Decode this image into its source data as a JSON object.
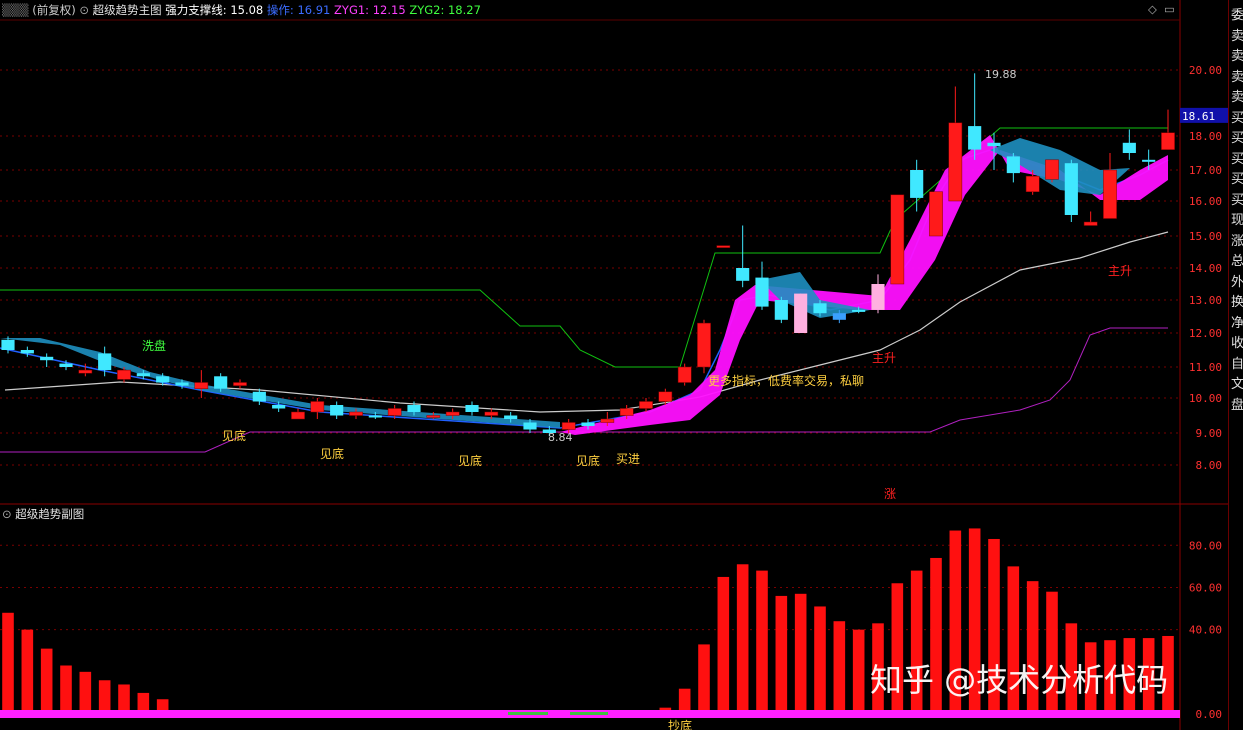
{
  "header": {
    "mode_label": "(前复权)",
    "indicator_title": "超级趋势主图",
    "support_label": "强力支撑线:",
    "support_value": "15.08",
    "op_label": "操作:",
    "op_value": "16.91",
    "zyg1_label": "ZYG1:",
    "zyg1_value": "12.15",
    "zyg2_label": "ZYG2:",
    "zyg2_value": "18.27",
    "sub_title": "超级趋势副图",
    "colors": {
      "title": "#e0e0e0",
      "support": "#ffffff",
      "op": "#3b6cff",
      "zyg1": "#ff40ff",
      "zyg2": "#40ff40"
    }
  },
  "sidebar": {
    "chars": [
      "委",
      "卖",
      "卖",
      "卖",
      "卖",
      "买",
      "买",
      "买",
      "买",
      "买",
      "现",
      "涨",
      "总",
      "外",
      "换",
      "净",
      "收",
      "自",
      "文",
      "盘"
    ]
  },
  "watermark": "知乎 @技术分析代码",
  "chart_data": [
    {
      "type": "candlestick",
      "title": "超级趋势主图",
      "ylim": [
        7.7,
        20.8
      ],
      "yticks": [
        "8.00",
        "9.00",
        "10.00",
        "11.00",
        "12.00",
        "13.00",
        "14.00",
        "15.00",
        "16.00",
        "17.00",
        "18.00",
        "20.00"
      ],
      "current_price": "18.61",
      "high_mark": "19.88",
      "low_mark": "8.84",
      "up_color": "#ff2020",
      "down_color": "#40e8ff",
      "candles": [
        [
          11.8,
          11.9,
          11.5,
          11.4,
          0
        ],
        [
          11.5,
          11.6,
          11.4,
          11.3,
          0
        ],
        [
          11.3,
          11.4,
          11.2,
          11.0,
          0
        ],
        [
          11.1,
          11.2,
          11.0,
          10.9,
          0
        ],
        [
          10.9,
          11.1,
          10.8,
          10.7,
          1
        ],
        [
          11.4,
          11.6,
          10.9,
          10.7,
          0
        ],
        [
          10.9,
          11.0,
          10.6,
          10.5,
          1
        ],
        [
          10.8,
          10.9,
          10.7,
          10.6,
          0
        ],
        [
          10.7,
          10.8,
          10.5,
          10.4,
          0
        ],
        [
          10.5,
          10.6,
          10.4,
          10.3,
          0
        ],
        [
          10.5,
          10.9,
          10.3,
          10.0,
          1
        ],
        [
          10.7,
          10.8,
          10.3,
          10.2,
          0
        ],
        [
          10.5,
          10.6,
          10.4,
          10.3,
          1
        ],
        [
          10.2,
          10.3,
          9.9,
          9.8,
          0
        ],
        [
          9.8,
          9.9,
          9.7,
          9.6,
          0
        ],
        [
          9.4,
          9.7,
          9.6,
          9.4,
          1
        ],
        [
          9.9,
          10.0,
          9.6,
          9.4,
          1
        ],
        [
          9.8,
          9.9,
          9.5,
          9.4,
          0
        ],
        [
          9.6,
          9.7,
          9.5,
          9.4,
          1
        ],
        [
          9.5,
          9.6,
          9.5,
          9.4,
          0
        ],
        [
          9.7,
          9.8,
          9.5,
          9.4,
          1
        ],
        [
          9.8,
          9.9,
          9.6,
          9.5,
          0
        ],
        [
          9.5,
          9.6,
          9.5,
          9.4,
          1
        ],
        [
          9.6,
          9.7,
          9.5,
          9.4,
          1
        ],
        [
          9.8,
          9.9,
          9.6,
          9.5,
          0
        ],
        [
          9.6,
          9.7,
          9.5,
          9.4,
          1
        ],
        [
          9.5,
          9.6,
          9.4,
          9.3,
          0
        ],
        [
          9.3,
          9.4,
          9.1,
          9.0,
          0
        ],
        [
          9.1,
          9.2,
          9.0,
          8.9,
          0
        ],
        [
          9.3,
          9.4,
          9.1,
          9.0,
          1
        ],
        [
          9.3,
          9.4,
          9.2,
          9.1,
          0
        ],
        [
          9.4,
          9.6,
          9.3,
          9.2,
          1
        ],
        [
          9.7,
          9.8,
          9.5,
          9.4,
          1
        ],
        [
          9.9,
          10.0,
          9.7,
          9.6,
          1
        ],
        [
          10.2,
          10.3,
          9.9,
          9.8,
          1
        ],
        [
          11.0,
          11.1,
          10.5,
          10.4,
          1
        ],
        [
          12.3,
          12.4,
          11.0,
          10.8,
          1
        ],
        [
          14.7,
          14.7,
          14.7,
          14.7,
          1
        ],
        [
          14.0,
          15.3,
          13.6,
          13.4,
          0
        ],
        [
          13.7,
          14.2,
          12.8,
          12.7,
          0
        ],
        [
          13.0,
          13.1,
          12.4,
          12.3,
          0
        ],
        [
          13.2,
          13.2,
          12.0,
          12.0,
          2
        ],
        [
          12.9,
          13.0,
          12.6,
          12.5,
          0
        ],
        [
          12.6,
          12.7,
          12.4,
          12.3,
          3
        ],
        [
          12.7,
          12.8,
          12.7,
          12.6,
          0
        ],
        [
          12.7,
          13.8,
          13.5,
          12.6,
          2
        ],
        [
          13.5,
          16.0,
          16.2,
          13.5,
          1
        ],
        [
          16.1,
          17.3,
          17.0,
          15.7,
          0
        ],
        [
          15.0,
          16.0,
          16.3,
          15.0,
          1
        ],
        [
          16.0,
          19.5,
          18.4,
          16.0,
          1
        ],
        [
          18.3,
          19.9,
          17.6,
          17.3,
          0
        ],
        [
          17.7,
          18.1,
          17.8,
          17.0,
          0
        ],
        [
          17.4,
          17.5,
          16.9,
          16.6,
          0
        ],
        [
          16.8,
          17.0,
          16.3,
          16.2,
          1
        ],
        [
          16.7,
          17.3,
          17.3,
          16.6,
          1
        ],
        [
          17.2,
          17.3,
          15.6,
          15.4,
          0
        ],
        [
          15.4,
          15.7,
          15.3,
          15.3,
          1
        ],
        [
          15.5,
          17.5,
          17.0,
          15.5,
          1
        ],
        [
          17.8,
          18.2,
          17.5,
          17.3,
          0
        ],
        [
          17.3,
          17.6,
          17.3,
          17.0,
          0
        ],
        [
          17.6,
          18.8,
          18.1,
          17.6,
          1
        ]
      ],
      "annotations": [
        "洗盘",
        "见底",
        "见底",
        "见底",
        "见底",
        "买进",
        "主升",
        "主升",
        "更多指标，低费率交易，私聊",
        "涨"
      ]
    },
    {
      "type": "bar",
      "title": "超级趋势副图",
      "ylim": [
        0,
        92
      ],
      "yticks": [
        "0.00",
        "40.00",
        "60.00",
        "80.00"
      ],
      "values": [
        48,
        40,
        31,
        23,
        20,
        16,
        14,
        10,
        7,
        0,
        0,
        0,
        0,
        0,
        0,
        0,
        0,
        0,
        0,
        0,
        0,
        0,
        0,
        0,
        0,
        0,
        0,
        0,
        0,
        0,
        0,
        0,
        0,
        0,
        3,
        12,
        33,
        65,
        71,
        68,
        56,
        57,
        51,
        44,
        40,
        43,
        62,
        68,
        74,
        87,
        88,
        83,
        70,
        63,
        58,
        43,
        34,
        35,
        36,
        36,
        37
      ],
      "bar_color": "#ff1010",
      "baseline_color": "#ff20ff",
      "annotation": "抄底"
    }
  ]
}
